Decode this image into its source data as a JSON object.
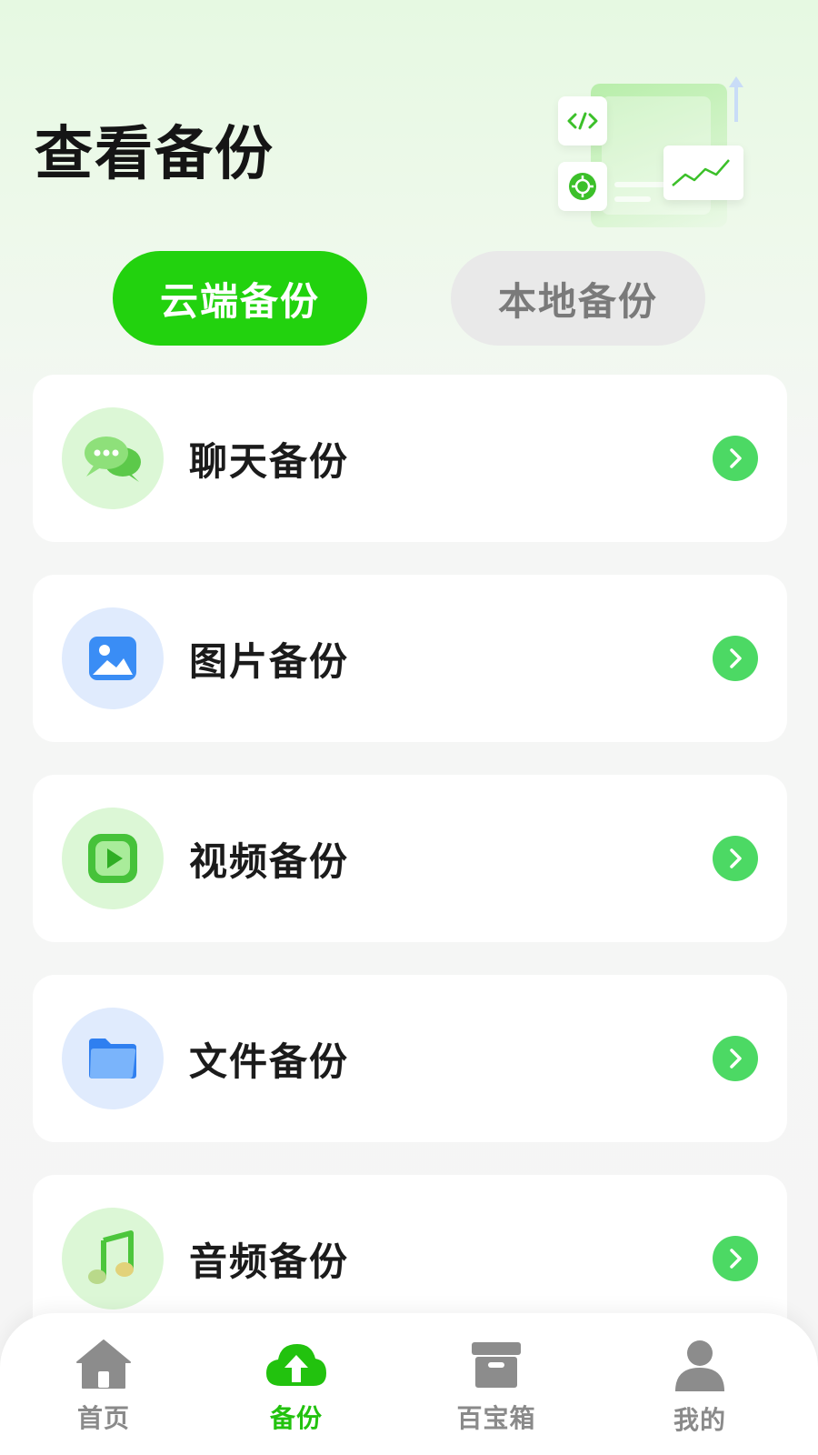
{
  "page": {
    "title": "查看备份"
  },
  "tabs": [
    {
      "label": "云端备份",
      "active": true
    },
    {
      "label": "本地备份",
      "active": false
    }
  ],
  "backup_items": [
    {
      "label": "聊天备份",
      "icon": "chat-bubbles-icon"
    },
    {
      "label": "图片备份",
      "icon": "image-icon"
    },
    {
      "label": "视频备份",
      "icon": "video-play-icon"
    },
    {
      "label": "文件备份",
      "icon": "folder-icon"
    },
    {
      "label": "音频备份",
      "icon": "music-note-icon"
    }
  ],
  "bottom_nav": [
    {
      "label": "首页",
      "icon": "home-icon",
      "active": false
    },
    {
      "label": "备份",
      "icon": "cloud-upload-icon",
      "active": true
    },
    {
      "label": "百宝箱",
      "icon": "box-icon",
      "active": false
    },
    {
      "label": "我的",
      "icon": "user-icon",
      "active": false
    }
  ],
  "colors": {
    "accent": "#22d20e",
    "chevron": "#4cd964",
    "tab_inactive_bg": "#e9e9e9",
    "nav_inactive": "#8a8a8a"
  }
}
